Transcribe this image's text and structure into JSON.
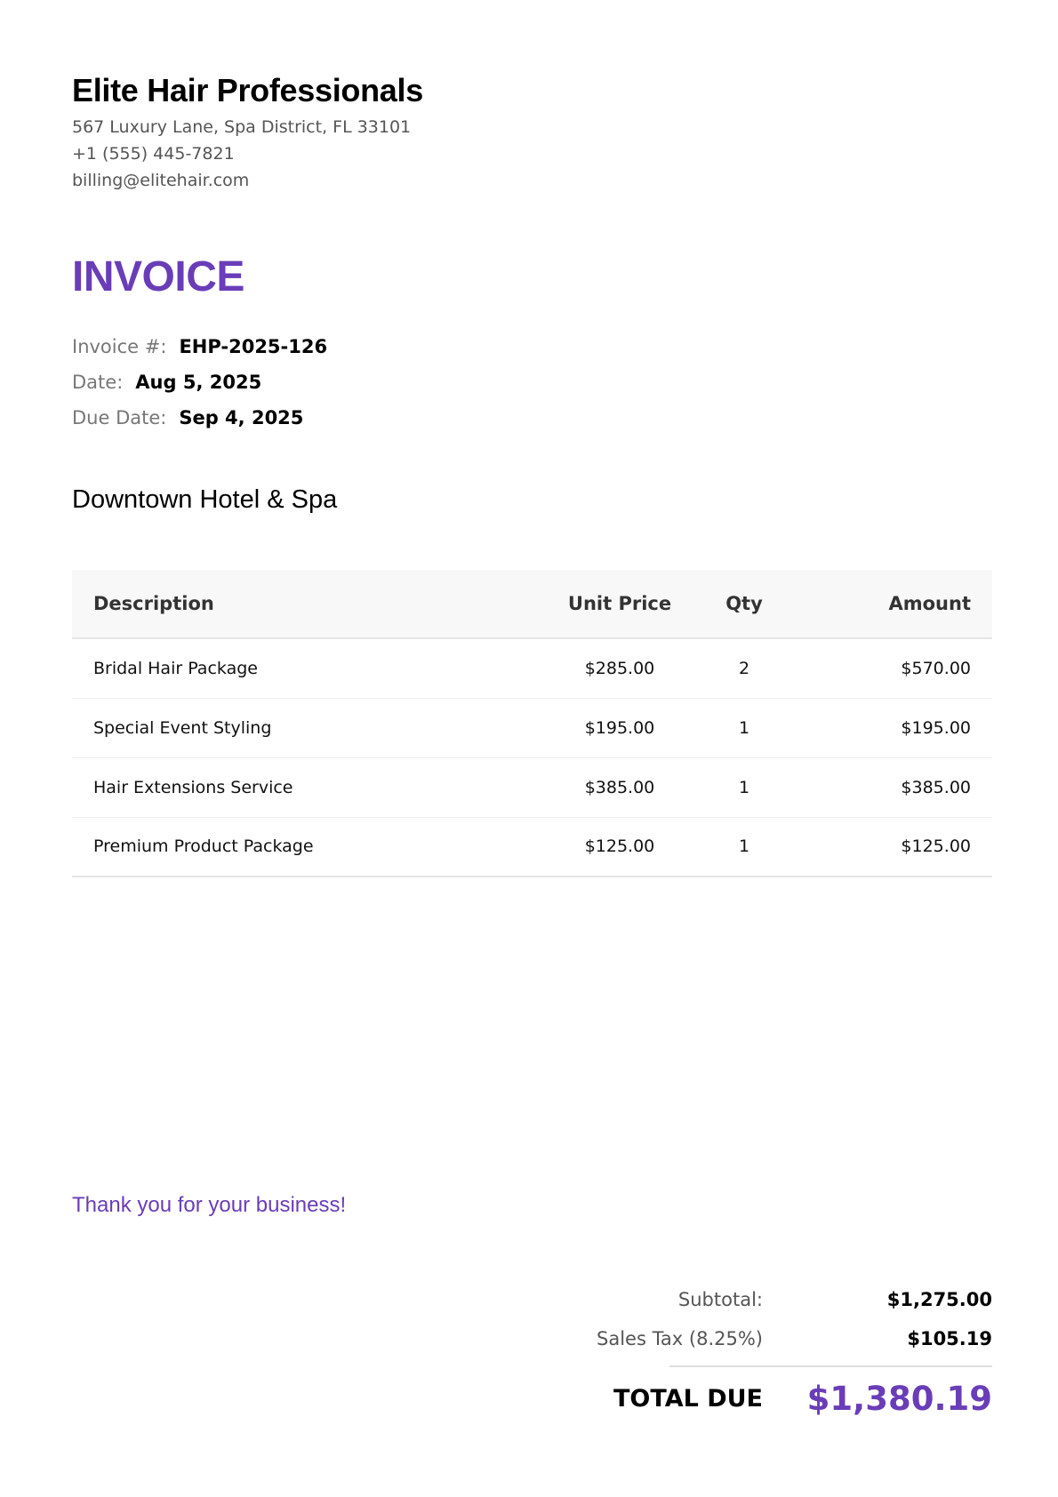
{
  "company": {
    "name": "Elite Hair Professionals",
    "address": "567 Luxury Lane, Spa District, FL 33101",
    "phone": "+1 (555) 445-7821",
    "email": "billing@elitehair.com"
  },
  "invoice": {
    "title": "INVOICE",
    "number_label": "Invoice #:",
    "number": "EHP-2025-126",
    "date_label": "Date:",
    "date": "Aug 5, 2025",
    "due_label": "Due Date:",
    "due_date": "Sep 4, 2025"
  },
  "client": {
    "name": "Downtown Hotel & Spa"
  },
  "table": {
    "headers": {
      "description": "Description",
      "unit_price": "Unit Price",
      "qty": "Qty",
      "amount": "Amount"
    },
    "rows": [
      {
        "description": "Bridal Hair Package",
        "unit_price": "$285.00",
        "qty": "2",
        "amount": "$570.00"
      },
      {
        "description": "Special Event Styling",
        "unit_price": "$195.00",
        "qty": "1",
        "amount": "$195.00"
      },
      {
        "description": "Hair Extensions Service",
        "unit_price": "$385.00",
        "qty": "1",
        "amount": "$385.00"
      },
      {
        "description": "Premium Product Package",
        "unit_price": "$125.00",
        "qty": "1",
        "amount": "$125.00"
      }
    ]
  },
  "footer": {
    "thanks": "Thank you for your business!"
  },
  "totals": {
    "subtotal_label": "Subtotal:",
    "subtotal": "$1,275.00",
    "tax_label": "Sales Tax (8.25%)",
    "tax": "$105.19",
    "total_label": "TOTAL DUE",
    "total": "$1,380.19"
  },
  "colors": {
    "accent": "#6a3db8",
    "text": "#111111",
    "muted": "#555555"
  }
}
